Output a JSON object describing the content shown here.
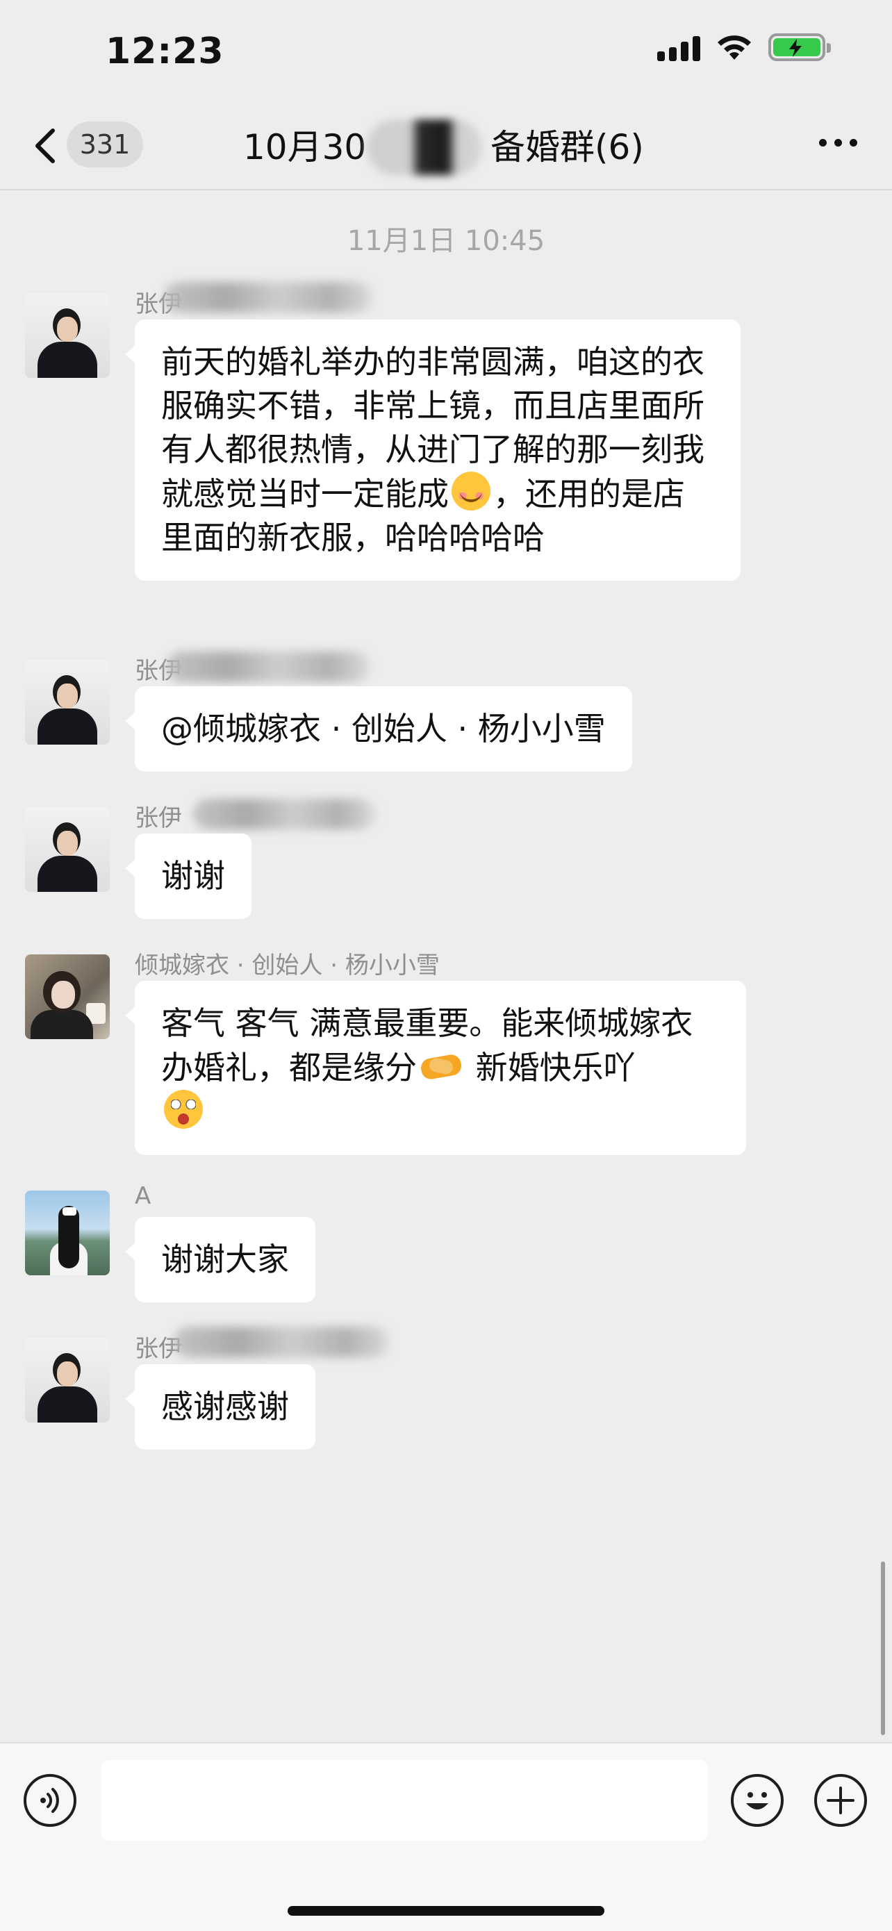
{
  "status_bar": {
    "time": "12:23"
  },
  "nav": {
    "back_count": "331",
    "title_prefix": "10月30",
    "title_suffix": "备婚群(6)"
  },
  "timestamp": "11月1日 10:45",
  "messages": [
    {
      "sender": "张伊",
      "text": "前天的婚礼举办的非常圆满，咱这的衣服确实不错，非常上镜，而且店里面所有人都很热情，从进门了解的那一刻我就感觉当时一定能成",
      "emoji": "relieved-face",
      "text_after": "，还用的是店里面的新衣服，哈哈哈哈哈"
    },
    {
      "sender": "张伊",
      "text": "@倾城嫁衣 · 创始人 · 杨小小雪"
    },
    {
      "sender": "张伊",
      "text": "谢谢"
    },
    {
      "sender": "倾城嫁衣 · 创始人 · 杨小小雪",
      "text": "客气 客气 满意最重要。能来倾城嫁衣办婚礼，都是缘分",
      "emoji": "handshake",
      "text_after": " 新婚快乐吖",
      "emoji2": "astonished-face"
    },
    {
      "sender": "A",
      "text": "谢谢大家"
    },
    {
      "sender": "张伊",
      "text": "感谢感谢"
    }
  ],
  "icons": {
    "back": "chevron-left-icon",
    "more": "more-dots-icon",
    "voice": "voice-icon",
    "emoji": "emoji-icon",
    "add": "plus-icon"
  },
  "colors": {
    "background": "#ededed",
    "bubble": "#ffffff",
    "battery": "#36c94a"
  }
}
